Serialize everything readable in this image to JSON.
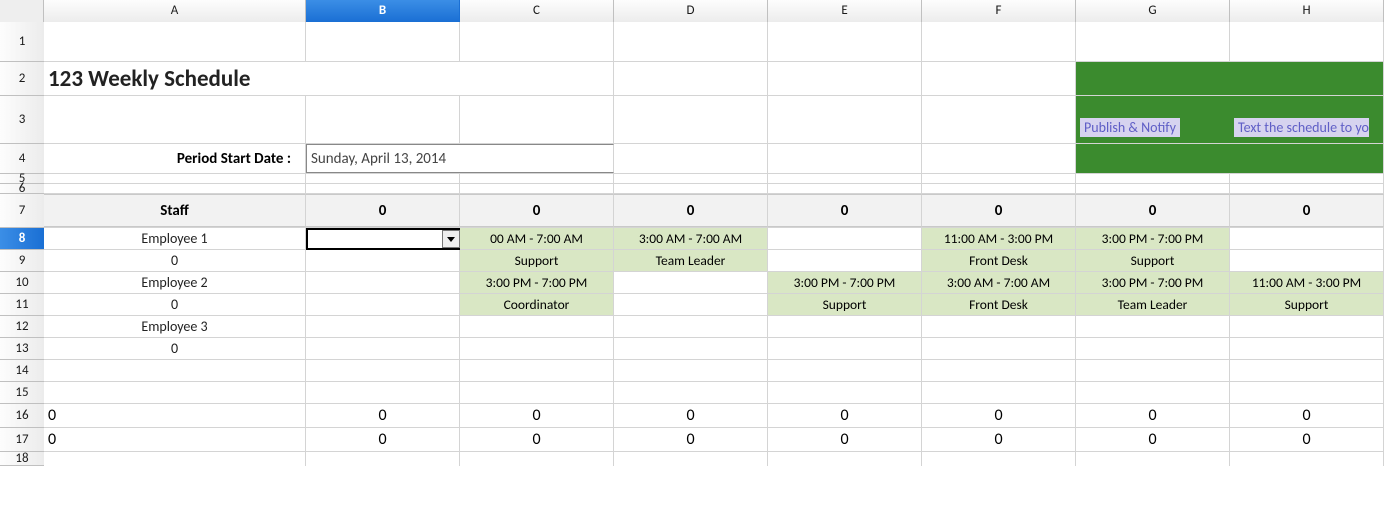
{
  "columns": [
    "A",
    "B",
    "C",
    "D",
    "E",
    "F",
    "G",
    "H"
  ],
  "selected_column_index": 1,
  "rows": [
    "1",
    "2",
    "3",
    "4",
    "5",
    "6",
    "7",
    "8",
    "9",
    "10",
    "11",
    "12",
    "13",
    "14",
    "15",
    "16",
    "17",
    "18"
  ],
  "selected_row_index": 7,
  "title": "123 Weekly Schedule",
  "period_label": "Period Start Date :",
  "period_value": "Sunday, April 13, 2014",
  "action_banner": {
    "publish_label": "Publish & Notify",
    "text_label": "Text the schedule to yo"
  },
  "header_row": {
    "staff": "Staff",
    "zeros": [
      "0",
      "0",
      "0",
      "0",
      "0",
      "0",
      "0"
    ]
  },
  "employees": [
    {
      "name": "Employee 1",
      "sub": "0",
      "shifts_top": [
        "",
        "00 AM - 7:00 AM",
        "3:00 AM - 7:00 AM",
        "",
        "11:00 AM - 3:00 PM",
        "3:00 PM - 7:00 PM",
        ""
      ],
      "shifts_role": [
        "",
        "Support",
        "Team Leader",
        "",
        "Front Desk",
        "Support",
        ""
      ]
    },
    {
      "name": "Employee 2",
      "sub": "0",
      "shifts_top": [
        "",
        "3:00 PM - 7:00 PM",
        "",
        "3:00 PM - 7:00 PM",
        "3:00 AM - 7:00 AM",
        "3:00 PM - 7:00 PM",
        "11:00 AM - 3:00 PM"
      ],
      "shifts_role": [
        "",
        "Coordinator",
        "",
        "Support",
        "Front Desk",
        "Team Leader",
        "Support"
      ]
    },
    {
      "name": "Employee 3",
      "sub": "0",
      "shifts_top": [
        "",
        "",
        "",
        "",
        "",
        "",
        ""
      ],
      "shifts_role": [
        "",
        "",
        "",
        "",
        "",
        "",
        ""
      ]
    }
  ],
  "totals_rows": [
    [
      "0",
      "0",
      "0",
      "0",
      "0",
      "0",
      "0",
      "0"
    ],
    [
      "0",
      "0",
      "0",
      "0",
      "0",
      "0",
      "0",
      "0"
    ]
  ],
  "active_cell": "B8"
}
